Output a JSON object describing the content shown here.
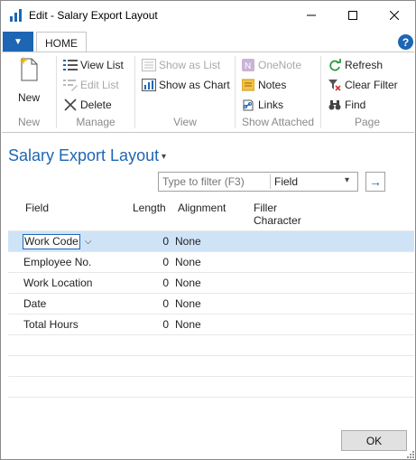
{
  "window": {
    "title": "Edit - Salary Export Layout",
    "minimize_glyph": "─",
    "maximize_glyph": "☐",
    "close_glyph": "✕"
  },
  "ribbon": {
    "app_menu_glyph": "▼",
    "tab_home": "HOME",
    "help_glyph": "?",
    "groups": {
      "new": {
        "label": "New",
        "new_button": "New"
      },
      "manage": {
        "label": "Manage",
        "view_list": "View List",
        "edit_list": "Edit List",
        "delete": "Delete"
      },
      "view": {
        "label": "View",
        "show_as_list": "Show as List",
        "show_as_chart": "Show as Chart"
      },
      "show_attached": {
        "label": "Show Attached",
        "onenote": "OneNote",
        "notes": "Notes",
        "links": "Links"
      },
      "page": {
        "label": "Page",
        "refresh": "Refresh",
        "clear_filter": "Clear Filter",
        "find": "Find"
      }
    }
  },
  "page": {
    "title": "Salary Export Layout",
    "title_caret": "▾"
  },
  "filter": {
    "placeholder": "Type to filter (F3)",
    "field_selected": "Field",
    "caret": "▾",
    "go_glyph": "→"
  },
  "grid": {
    "headers": {
      "field": "Field",
      "length": "Length",
      "alignment": "Alignment",
      "filler_1": "Filler",
      "filler_2": "Character"
    },
    "rows": [
      {
        "field": "Work Code",
        "length": "0",
        "alignment": "None"
      },
      {
        "field": "Employee No.",
        "length": "0",
        "alignment": "None"
      },
      {
        "field": "Work Location",
        "length": "0",
        "alignment": "None"
      },
      {
        "field": "Date",
        "length": "0",
        "alignment": "None"
      },
      {
        "field": "Total Hours",
        "length": "0",
        "alignment": "None"
      }
    ],
    "dropdown_glyph": "⌵"
  },
  "footer": {
    "ok_label": "OK"
  },
  "colors": {
    "accent": "#1e66b4",
    "selected_row": "#cfe3f7",
    "disabled_text": "#a8a8a8"
  }
}
